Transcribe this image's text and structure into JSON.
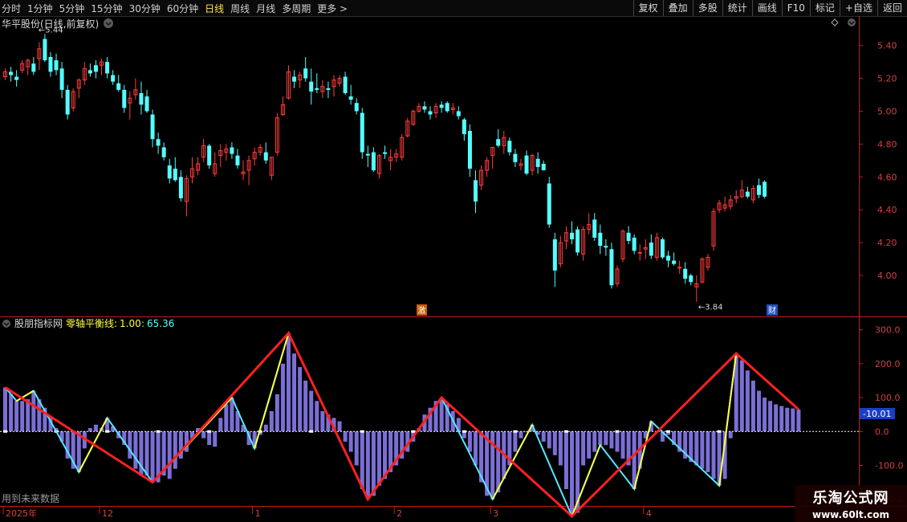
{
  "toolbar": {
    "timeframes": [
      "分时",
      "1分钟",
      "5分钟",
      "15分钟",
      "30分钟",
      "60分钟",
      "日线",
      "周线",
      "月线",
      "多周期",
      "更多 >"
    ],
    "active_timeframe": "日线",
    "buttons": [
      "复权",
      "叠加",
      "多股",
      "统计",
      "画线",
      "F10",
      "标记",
      "+自选",
      "返回"
    ]
  },
  "main_panel": {
    "title": "华平股份(日线,前复权)",
    "high_marker": "5.44",
    "low_marker": "3.84",
    "event_badge_1": "激",
    "event_badge_2": "财"
  },
  "indicator_panel": {
    "name": "股朋指标网",
    "line_label": "零轴平衡线:",
    "v1": "1.00",
    "v2": "65.36",
    "current_value": "-10.01"
  },
  "footer": {
    "future_data_note": "用到未来数据",
    "dates": [
      "2025年",
      "12",
      "1",
      "2",
      "3",
      "4"
    ]
  },
  "watermark": {
    "name": "乐淘公式网",
    "url": "www.60lt.com"
  },
  "colors": {
    "up": "#ff3d3d",
    "down": "#54ffff",
    "zero_line": "#ffffff",
    "bar": "#7b6fd6",
    "red_zig": "#ff2020",
    "yellow_zig": "#ffff40",
    "cyan_zig": "#54e8ff",
    "axis": "#c02020"
  },
  "chart_data": [
    {
      "type": "candlestick",
      "ylim": [
        3.77,
        5.55
      ],
      "yticks": [
        4.0,
        4.2,
        4.4,
        4.6,
        4.8,
        5.0,
        5.2,
        5.4
      ],
      "ohlc": [
        [
          5.21,
          5.26,
          5.19,
          5.24
        ],
        [
          5.24,
          5.27,
          5.18,
          5.22
        ],
        [
          5.21,
          5.25,
          5.15,
          5.19
        ],
        [
          5.25,
          5.31,
          5.23,
          5.29
        ],
        [
          5.27,
          5.32,
          5.22,
          5.31
        ],
        [
          5.29,
          5.33,
          5.22,
          5.24
        ],
        [
          5.32,
          5.42,
          5.25,
          5.38
        ],
        [
          5.44,
          5.47,
          5.3,
          5.31
        ],
        [
          5.33,
          5.36,
          5.21,
          5.24
        ],
        [
          5.31,
          5.35,
          5.22,
          5.25
        ],
        [
          5.26,
          5.3,
          5.08,
          5.13
        ],
        [
          5.13,
          5.16,
          4.95,
          4.98
        ],
        [
          5.02,
          5.14,
          5.0,
          5.12
        ],
        [
          5.14,
          5.2,
          5.08,
          5.19
        ],
        [
          5.19,
          5.3,
          5.16,
          5.26
        ],
        [
          5.25,
          5.29,
          5.21,
          5.23
        ],
        [
          5.28,
          5.31,
          5.2,
          5.24
        ],
        [
          5.28,
          5.32,
          5.22,
          5.3
        ],
        [
          5.3,
          5.33,
          5.2,
          5.23
        ],
        [
          5.22,
          5.25,
          5.16,
          5.18
        ],
        [
          5.17,
          5.22,
          5.12,
          5.13
        ],
        [
          5.13,
          5.16,
          4.99,
          5.02
        ],
        [
          5.05,
          5.12,
          4.95,
          5.08
        ],
        [
          5.1,
          5.2,
          5.07,
          5.13
        ],
        [
          5.11,
          5.18,
          4.98,
          5.04
        ],
        [
          5.09,
          5.13,
          4.99,
          5.0
        ],
        [
          4.98,
          5.01,
          4.78,
          4.83
        ],
        [
          4.83,
          4.87,
          4.74,
          4.79
        ],
        [
          4.78,
          4.81,
          4.7,
          4.72
        ],
        [
          4.67,
          4.71,
          4.56,
          4.59
        ],
        [
          4.65,
          4.72,
          4.57,
          4.58
        ],
        [
          4.6,
          4.64,
          4.45,
          4.47
        ],
        [
          4.45,
          4.61,
          4.36,
          4.59
        ],
        [
          4.6,
          4.72,
          4.56,
          4.65
        ],
        [
          4.64,
          4.72,
          4.61,
          4.68
        ],
        [
          4.72,
          4.83,
          4.69,
          4.79
        ],
        [
          4.79,
          4.8,
          4.65,
          4.67
        ],
        [
          4.62,
          4.75,
          4.6,
          4.68
        ],
        [
          4.73,
          4.8,
          4.66,
          4.76
        ],
        [
          4.75,
          4.8,
          4.7,
          4.77
        ],
        [
          4.78,
          4.81,
          4.71,
          4.74
        ],
        [
          4.73,
          4.77,
          4.65,
          4.67
        ],
        [
          4.62,
          4.7,
          4.58,
          4.63
        ],
        [
          4.64,
          4.73,
          4.55,
          4.7
        ],
        [
          4.71,
          4.78,
          4.67,
          4.75
        ],
        [
          4.75,
          4.8,
          4.73,
          4.78
        ],
        [
          4.75,
          4.81,
          4.68,
          4.7
        ],
        [
          4.61,
          4.72,
          4.58,
          4.72
        ],
        [
          4.75,
          4.99,
          4.73,
          4.96
        ],
        [
          4.98,
          5.09,
          4.97,
          5.04
        ],
        [
          5.08,
          5.28,
          5.07,
          5.24
        ],
        [
          5.21,
          5.25,
          5.14,
          5.18
        ],
        [
          5.19,
          5.24,
          5.14,
          5.22
        ],
        [
          5.26,
          5.33,
          5.18,
          5.2
        ],
        [
          5.18,
          5.26,
          5.04,
          5.12
        ],
        [
          5.14,
          5.23,
          5.11,
          5.13
        ],
        [
          5.12,
          5.19,
          5.08,
          5.15
        ],
        [
          5.14,
          5.18,
          5.08,
          5.13
        ],
        [
          5.15,
          5.22,
          5.09,
          5.19
        ],
        [
          5.17,
          5.22,
          5.15,
          5.2
        ],
        [
          5.21,
          5.24,
          5.1,
          5.11
        ],
        [
          5.09,
          5.16,
          5.04,
          5.07
        ],
        [
          5.05,
          5.08,
          4.98,
          5.0
        ],
        [
          4.99,
          5.02,
          4.71,
          4.75
        ],
        [
          4.74,
          4.79,
          4.66,
          4.73
        ],
        [
          4.75,
          4.78,
          4.63,
          4.64
        ],
        [
          4.62,
          4.74,
          4.59,
          4.73
        ],
        [
          4.75,
          4.79,
          4.71,
          4.74
        ],
        [
          4.7,
          4.77,
          4.64,
          4.72
        ],
        [
          4.72,
          4.77,
          4.69,
          4.74
        ],
        [
          4.72,
          4.86,
          4.7,
          4.84
        ],
        [
          4.85,
          4.96,
          4.84,
          4.94
        ],
        [
          4.92,
          5.01,
          4.91,
          5.0
        ],
        [
          5.0,
          5.05,
          4.99,
          5.03
        ],
        [
          5.03,
          5.06,
          4.99,
          5.01
        ],
        [
          5.0,
          5.03,
          4.95,
          4.98
        ],
        [
          4.99,
          5.05,
          4.96,
          5.03
        ],
        [
          5.04,
          5.06,
          4.99,
          5.02
        ],
        [
          5.05,
          5.06,
          4.99,
          5.0
        ],
        [
          5.01,
          5.05,
          4.98,
          5.02
        ],
        [
          5.0,
          5.03,
          4.95,
          4.97
        ],
        [
          4.95,
          4.96,
          4.82,
          4.86
        ],
        [
          4.88,
          4.92,
          4.6,
          4.65
        ],
        [
          4.58,
          4.64,
          4.38,
          4.45
        ],
        [
          4.55,
          4.67,
          4.52,
          4.64
        ],
        [
          4.64,
          4.72,
          4.6,
          4.7
        ],
        [
          4.73,
          4.78,
          4.65,
          4.78
        ],
        [
          4.83,
          4.89,
          4.78,
          4.79
        ],
        [
          4.79,
          4.88,
          4.74,
          4.84
        ],
        [
          4.82,
          4.84,
          4.73,
          4.75
        ],
        [
          4.74,
          4.77,
          4.66,
          4.69
        ],
        [
          4.67,
          4.71,
          4.64,
          4.68
        ],
        [
          4.73,
          4.76,
          4.61,
          4.62
        ],
        [
          4.64,
          4.74,
          4.61,
          4.73
        ],
        [
          4.71,
          4.75,
          4.62,
          4.66
        ],
        [
          4.68,
          4.7,
          4.64,
          4.64
        ],
        [
          4.56,
          4.6,
          4.29,
          4.31
        ],
        [
          4.22,
          4.26,
          3.93,
          4.03
        ],
        [
          4.07,
          4.24,
          4.05,
          4.2
        ],
        [
          4.21,
          4.3,
          4.16,
          4.26
        ],
        [
          4.26,
          4.33,
          4.19,
          4.22
        ],
        [
          4.28,
          4.3,
          4.12,
          4.14
        ],
        [
          4.13,
          4.3,
          4.09,
          4.28
        ],
        [
          4.28,
          4.38,
          4.25,
          4.31
        ],
        [
          4.34,
          4.38,
          4.21,
          4.23
        ],
        [
          4.26,
          4.31,
          4.13,
          4.18
        ],
        [
          4.18,
          4.22,
          4.12,
          4.17
        ],
        [
          4.16,
          4.2,
          3.92,
          3.94
        ],
        [
          3.95,
          4.06,
          3.93,
          4.04
        ],
        [
          4.1,
          4.28,
          4.08,
          4.27
        ],
        [
          4.26,
          4.3,
          4.19,
          4.21
        ],
        [
          4.23,
          4.25,
          4.13,
          4.15
        ],
        [
          4.14,
          4.19,
          4.09,
          4.14
        ],
        [
          4.16,
          4.22,
          4.1,
          4.17
        ],
        [
          4.2,
          4.25,
          4.1,
          4.12
        ],
        [
          4.11,
          4.26,
          4.09,
          4.23
        ],
        [
          4.22,
          4.23,
          4.1,
          4.11
        ],
        [
          4.12,
          4.15,
          4.05,
          4.09
        ],
        [
          4.09,
          4.14,
          4.06,
          4.07
        ],
        [
          4.05,
          4.09,
          4.01,
          4.05
        ],
        [
          4.04,
          4.08,
          3.95,
          3.98
        ],
        [
          4.0,
          4.01,
          3.94,
          3.96
        ],
        [
          3.93,
          4.0,
          3.84,
          3.95
        ],
        [
          3.96,
          4.11,
          3.95,
          4.1
        ],
        [
          4.05,
          4.13,
          4.03,
          4.11
        ],
        [
          4.18,
          4.41,
          4.15,
          4.39
        ],
        [
          4.4,
          4.46,
          4.38,
          4.44
        ],
        [
          4.41,
          4.48,
          4.39,
          4.43
        ],
        [
          4.42,
          4.49,
          4.4,
          4.46
        ],
        [
          4.47,
          4.52,
          4.44,
          4.48
        ],
        [
          4.48,
          4.58,
          4.47,
          4.52
        ],
        [
          4.51,
          4.54,
          4.47,
          4.48
        ],
        [
          4.46,
          4.55,
          4.44,
          4.53
        ],
        [
          4.55,
          4.59,
          4.47,
          4.49
        ],
        [
          4.57,
          4.58,
          4.47,
          4.48
        ]
      ]
    },
    {
      "type": "bar",
      "ylim": [
        -215,
        330
      ],
      "yticks": [
        300.0,
        200.0,
        100.0,
        0,
        -100.0,
        -200.0
      ],
      "values": [
        130,
        110,
        90,
        90,
        95,
        120,
        95,
        70,
        40,
        10,
        -30,
        -80,
        -110,
        -120,
        -50,
        10,
        20,
        10,
        40,
        15,
        -20,
        -40,
        -80,
        -110,
        -130,
        -130,
        -150,
        -150,
        -130,
        -140,
        -110,
        -80,
        -60,
        -20,
        10,
        -20,
        -40,
        -45,
        40,
        80,
        100,
        60,
        20,
        -40,
        -50,
        -10,
        20,
        60,
        110,
        200,
        290,
        230,
        190,
        150,
        120,
        90,
        60,
        50,
        40,
        30,
        -30,
        -60,
        -100,
        -170,
        -200,
        -190,
        -160,
        -140,
        -120,
        -100,
        -80,
        -60,
        -30,
        10,
        50,
        70,
        90,
        100,
        80,
        60,
        40,
        -20,
        -60,
        -100,
        -150,
        -190,
        -200,
        -180,
        -140,
        -100,
        -60,
        -20,
        0,
        20,
        -10,
        -30,
        -50,
        -70,
        -100,
        -170,
        -250,
        -240,
        -100,
        -80,
        -60,
        -40,
        -40,
        -50,
        -60,
        -80,
        -100,
        -170,
        -110,
        -20,
        30,
        0,
        -30,
        -10,
        -40,
        -60,
        -80,
        -90,
        -100,
        -110,
        -120,
        -140,
        -160,
        -140,
        -20,
        230,
        210,
        180,
        150,
        120,
        100,
        90,
        80,
        75,
        70,
        68,
        65
      ],
      "zero_markers": true
    }
  ]
}
